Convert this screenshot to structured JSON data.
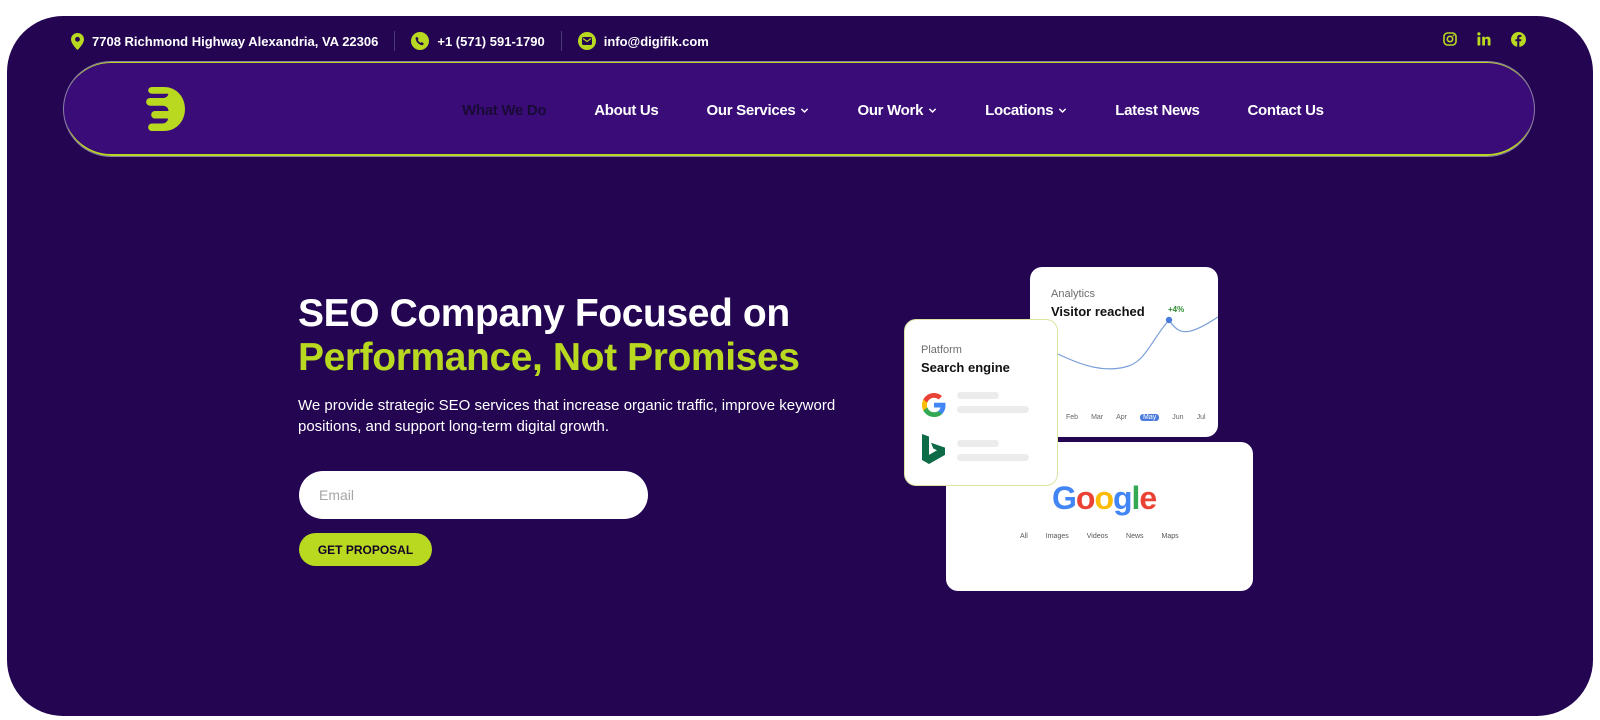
{
  "topbar": {
    "address": "7708 Richmond Highway Alexandria, VA 22306",
    "phone": "+1 (571) 591-1790",
    "email": "info@digifik.com",
    "social": [
      "instagram-icon",
      "linkedin-icon",
      "facebook-icon"
    ]
  },
  "nav": {
    "items": [
      {
        "label": "What We Do"
      },
      {
        "label": "About Us"
      },
      {
        "label": "Our Services"
      },
      {
        "label": "Our Work"
      },
      {
        "label": "Locations"
      },
      {
        "label": "Latest News"
      },
      {
        "label": "Contact Us"
      }
    ]
  },
  "hero": {
    "title_line1": "SEO Company Focused on",
    "title_line2": "Performance, Not Promises",
    "subtitle": "We provide strategic SEO services that increase organic traffic, improve keyword positions, and support long-term digital growth.",
    "email_placeholder": "Email",
    "cta_label": "GET PROPOSAL"
  },
  "cards": {
    "analytics": {
      "label": "Analytics",
      "title": "Visitor reached",
      "delta": "+4%",
      "months": [
        "Feb",
        "Mar",
        "Apr",
        "May",
        "Jun",
        "Jul"
      ],
      "active_month": "May"
    },
    "platform": {
      "label": "Platform",
      "title": "Search engine"
    },
    "google": {
      "logo_text": "Google",
      "tabs": [
        "All",
        "Images",
        "Videos",
        "News",
        "Maps"
      ]
    }
  },
  "colors": {
    "background": "#230552",
    "nav": "#3a0c78",
    "accent": "#b9d820"
  }
}
